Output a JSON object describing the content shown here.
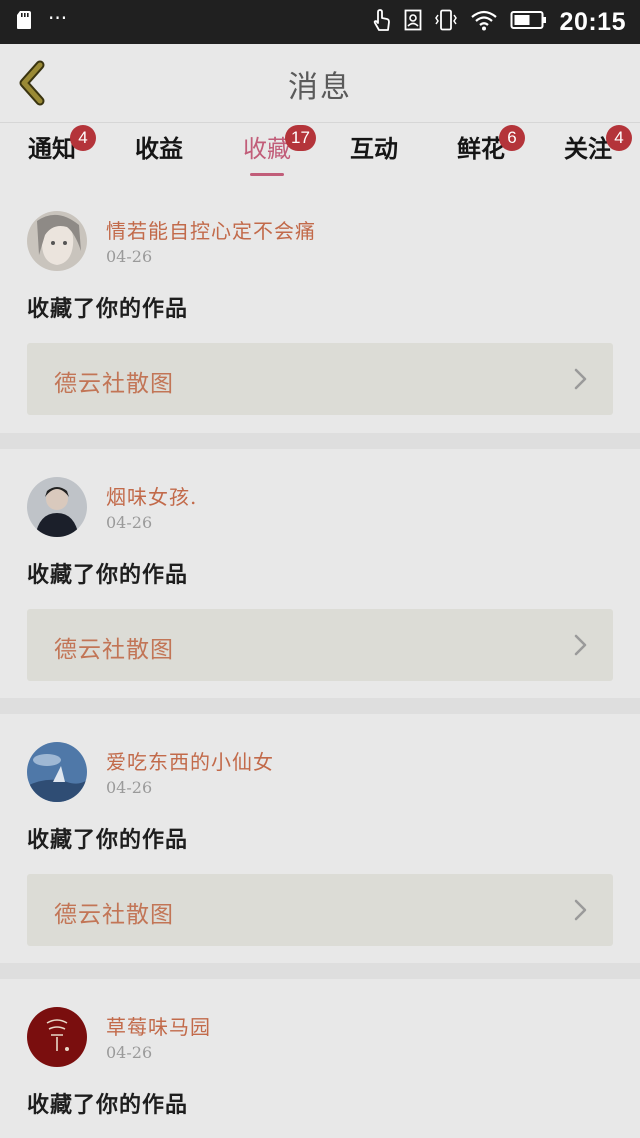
{
  "status_bar": {
    "left_icons": [
      "sd-card-icon",
      "more-dots-icon"
    ],
    "more_dots": "···",
    "right_icons": [
      "touch-icon",
      "portrait-icon",
      "vibrate-icon",
      "wifi-icon",
      "battery-icon"
    ],
    "time": "20:15"
  },
  "header": {
    "title": "消息",
    "back_icon": "chevron-left-icon"
  },
  "tabs": [
    {
      "label": "通知",
      "badge": "4",
      "active": false
    },
    {
      "label": "收益",
      "badge": "",
      "active": false
    },
    {
      "label": "收藏",
      "badge": "17",
      "active": true
    },
    {
      "label": "互动",
      "badge": "",
      "active": false
    },
    {
      "label": "鲜花",
      "badge": "6",
      "active": false
    },
    {
      "label": "关注",
      "badge": "4",
      "active": false
    }
  ],
  "messages": [
    {
      "username": "情若能自控心定不会痛",
      "date": "04-26",
      "action": "收藏了你的作品",
      "work_title": "德云社散图"
    },
    {
      "username": "烟味女孩.",
      "date": "04-26",
      "action": "收藏了你的作品",
      "work_title": "德云社散图"
    },
    {
      "username": "爱吃东西的小仙女",
      "date": "04-26",
      "action": "收藏了你的作品",
      "work_title": "德云社散图"
    },
    {
      "username": "草莓味马园",
      "date": "04-26",
      "action": "收藏了你的作品",
      "work_title": ""
    }
  ],
  "colors": {
    "accent": "#c15d79",
    "badge": "#b4343a",
    "username": "#c26a4a",
    "work_title": "#c27556",
    "back_icon": "#8a7a2a"
  }
}
